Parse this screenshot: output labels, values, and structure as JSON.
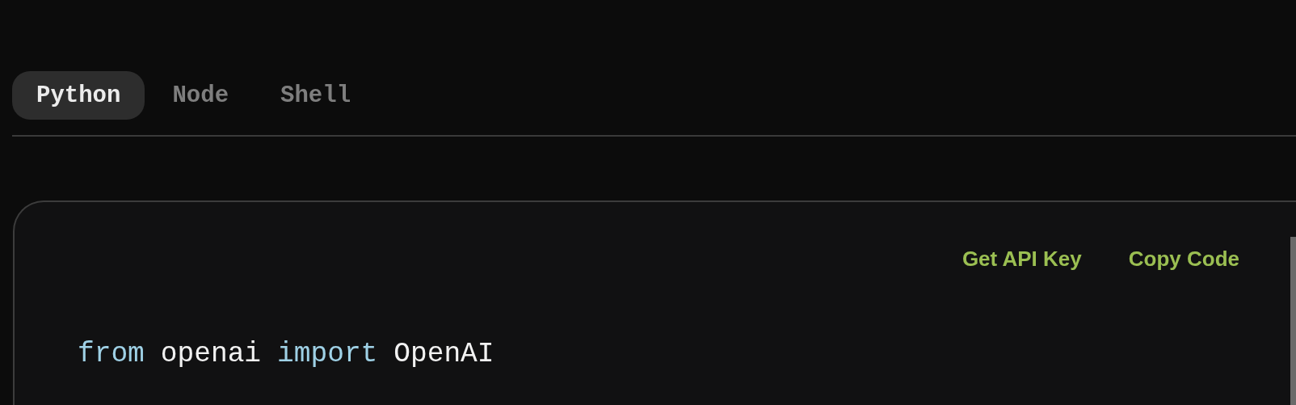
{
  "tabs": [
    {
      "label": "Python",
      "selected": true
    },
    {
      "label": "Node",
      "selected": false
    },
    {
      "label": "Shell",
      "selected": false
    }
  ],
  "code_panel": {
    "actions": [
      "Get API Key",
      "Copy Code"
    ],
    "lines": [
      [
        {
          "kind": "keyword",
          "text": "from"
        },
        {
          "kind": "plain",
          "text": "openai"
        },
        {
          "kind": "keyword",
          "text": "import"
        },
        {
          "kind": "plain",
          "text": "OpenAI"
        }
      ]
    ]
  }
}
